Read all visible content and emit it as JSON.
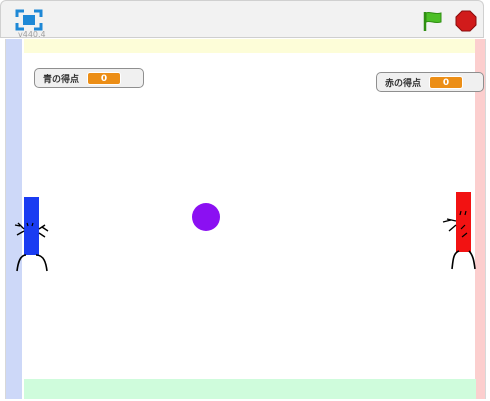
{
  "toolbar": {
    "version": "v440.4",
    "fullscreen_icon": "fullscreen-icon",
    "flag_icon": "green-flag-icon",
    "stop_icon": "stop-sign-icon",
    "flag_color": "#4cbf26",
    "stop_color": "#d11b1b"
  },
  "stage": {
    "monitors": {
      "blue": {
        "label": "青の得点",
        "value": "0"
      },
      "red": {
        "label": "赤の得点",
        "value": "0"
      }
    },
    "colors": {
      "blue_paddle": "#1a3cf2",
      "red_paddle": "#f21212",
      "ball": "#8b10f2",
      "top_wall": "#fdfdd8",
      "left_wall": "#cdd8f8",
      "right_wall": "#fccece",
      "bottom_wall": "#cffcdc",
      "monitor_value": "#ec8e16"
    }
  }
}
